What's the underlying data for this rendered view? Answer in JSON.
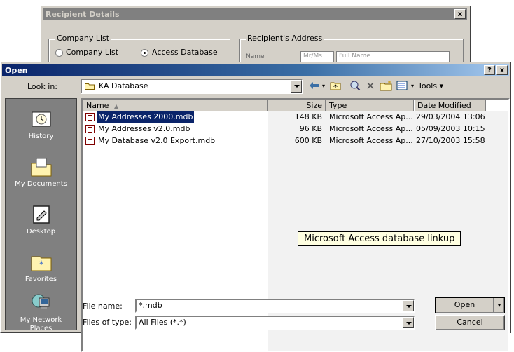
{
  "bg_dialog": {
    "title": "Recipient Details",
    "close_label": "x",
    "company_group": "Company List",
    "radio_company": "Company List",
    "radio_access": "Access Database",
    "address_group": "Recipient's Address",
    "name_label": "Name",
    "title_field": "Mr/Ms",
    "fullname_field": "Full Name"
  },
  "open_dialog": {
    "title": "Open",
    "help_label": "?",
    "close_label": "x",
    "lookin_label": "Look in:",
    "lookin_value": "KA Database",
    "tools_label": "Tools",
    "places": [
      {
        "label": "History",
        "icon": "history-icon"
      },
      {
        "label": "My Documents",
        "icon": "my-documents-icon"
      },
      {
        "label": "Desktop",
        "icon": "desktop-icon"
      },
      {
        "label": "Favorites",
        "icon": "favorites-icon"
      },
      {
        "label": "My Network Places",
        "icon": "network-places-icon"
      }
    ],
    "columns": [
      "Name",
      "Size",
      "Type",
      "Date Modified"
    ],
    "files": [
      {
        "name": "My Addresses 2000.mdb",
        "size": "148 KB",
        "type": "Microsoft Access Ap...",
        "date": "29/03/2004 13:06",
        "selected": true
      },
      {
        "name": "My Addresses v2.0.mdb",
        "size": "96 KB",
        "type": "Microsoft Access Ap...",
        "date": "05/09/2003 10:15",
        "selected": false
      },
      {
        "name": "My Database v2.0 Export.mdb",
        "size": "600 KB",
        "type": "Microsoft Access Ap...",
        "date": "27/10/2003 15:58",
        "selected": false
      }
    ],
    "tooltip": "Microsoft Access database linkup",
    "filename_label": "File name:",
    "filename_value": "*.mdb",
    "filetype_label": "Files of type:",
    "filetype_value": "All Files (*.*)",
    "open_button": "Open",
    "cancel_button": "Cancel"
  },
  "colors": {
    "title_active_start": "#0a246a",
    "title_active_end": "#a6caf0",
    "title_inactive": "#808080",
    "selection": "#0a246a",
    "face": "#d4d0c8",
    "tooltip_bg": "#ffffe1"
  }
}
